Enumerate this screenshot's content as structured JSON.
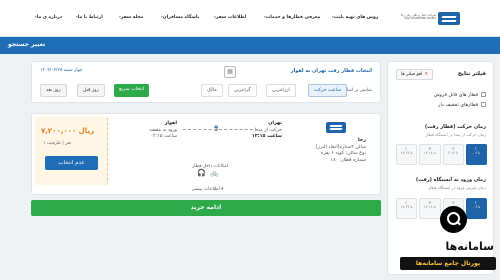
{
  "header": {
    "company": "شرکت حمل و نقل ریلی رجا",
    "company_sub": "RAJA PASSENGER TRAINS",
    "nav": [
      "روش های تهیه بلیت",
      "معرفی قطارها و خدمات",
      "اطلاعات سفر",
      "باشگاه مسافران",
      "مجله سفر",
      "ارتباط با ما",
      "درباره ی ما"
    ]
  },
  "subbar": {
    "change_search": "تغییر جستجو"
  },
  "filters": {
    "title": "فیلتر نتایج",
    "clear": "لغو فیلتر ها",
    "checkboxes": [
      "قطار های قابل فروش",
      "قطارهای تخفیف دار"
    ],
    "departure_title": "زمان حرکت (قطار رفت)",
    "departure_sub": "زمان حرکت از مبدا در ایستگاه قطار",
    "arrival_title": "زمان ورود به ایستگاه (رفت)",
    "arrival_sub": "زمان تقریبی ورود در ایستگاه قطار",
    "slots": [
      "۰ تا ۶",
      "۶ تا ۱۲",
      "۱۲ تا ۱۸",
      "۱۸ تا ۲۴"
    ]
  },
  "search": {
    "route": "انتخاب قطار رفت تهران به اهواز",
    "date": "چهار شنبه ۱۴۰۴/۰۲/۲۵",
    "sort_label": "نمایش بر اساس",
    "sort_options": [
      "ساعت حرکت",
      "ارزانترین",
      "گرانترین",
      "مالک"
    ],
    "quick_select": "انتخاب سریع",
    "prev_day": "روز قبل",
    "next_day": "روز بعد"
  },
  "train": {
    "price": "۷,۲۰۰,۰۰۰ ریال",
    "capacity": "۱ نفر | ظرفیت",
    "select": "عدم انتخاب",
    "owner": "رجا",
    "wagon_lines": [
      "سالن ۴ستاره(اتحاد البرز)",
      "نوع سالن: کوپه ۶ نفره",
      "شماره قطار: ۱۸۰"
    ],
    "origin": "تهران",
    "dep_time": "ساعت ۱۳:۱۵",
    "dep_label": "حرکت از مبدا",
    "destination": "اهواز",
    "arr_label": "ورود به مقصد",
    "arr_time": "ساعت ۰۲:۱۵",
    "amenities_label": "امکانات داخل قطار",
    "more_info": "اطلاعات بیشتر"
  },
  "actions": {
    "continue": "ادامه خرید"
  },
  "watermark": {
    "name": "سامانه‌ها",
    "tagline": "پورتال جامع سامانه‌ها"
  }
}
